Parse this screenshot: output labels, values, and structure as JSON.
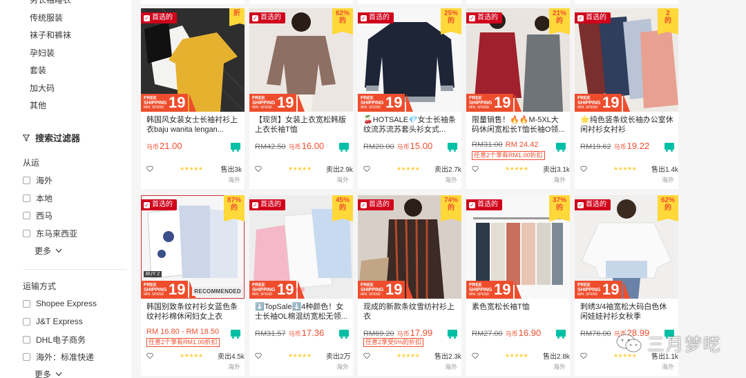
{
  "sidebar": {
    "categories": [
      "男长袖睡衣",
      "传统服装",
      "袜子和裤袜",
      "孕妇装",
      "套装",
      "加大码",
      "其他"
    ],
    "filter_title": "搜索过滤器",
    "ship_from": {
      "title": "从运",
      "options": [
        "海外",
        "本地",
        "西马",
        "东马来西亚"
      ],
      "more": "更多"
    },
    "shipping": {
      "title": "运输方式",
      "options": [
        "Shopee Express",
        "J&T Express",
        "DHL电子商务",
        "海外：标准快递"
      ],
      "more": "更多"
    }
  },
  "badges": {
    "pick": "首选的",
    "free_shipping": "FREE SHIPPING",
    "min_spend": "MIN. SPEND",
    "spend_amount": "19",
    "recommended": "RECOMMENDED",
    "buy2": "BUY 2",
    "disc_suffix": "折",
    "disc_small": "的"
  },
  "colors": {
    "brand": "#ee4d2d",
    "pick": "#d0011b",
    "star": "#ffce3d",
    "free": "#00bfa5"
  },
  "products": [
    {
      "title": "韩国风女装女士长袖衬衫上衣baju wanita lengan...",
      "orig": "",
      "price": "21.00",
      "currency": "马币",
      "promo": "",
      "sold": "售出3k",
      "loc": "海外",
      "disc": ""
    },
    {
      "title": "【现货】女装上衣宽松韩版上衣长袖T恤",
      "orig": "RM42.50",
      "price": "16.00",
      "currency": "马币",
      "promo": "",
      "sold": "卖出2.9k",
      "loc": "海外",
      "disc": "62%"
    },
    {
      "title": "🍒HOTSALE💎女士长袖条纹流苏流苏套头衫女式...",
      "orig": "RM20.00",
      "price": "15.00",
      "currency": "马币",
      "promo": "",
      "sold": "卖出2.7k",
      "loc": "海外",
      "disc": "25%"
    },
    {
      "title": "限量销售！🔥🔥M-5XL大码休闲宽松长T恤长袖O领...",
      "orig": "RM31.00",
      "price": "RM 24.42",
      "currency": "",
      "promo": "任意2个享有RM1.00折扣",
      "sold": "卖出3.1k",
      "loc": "海外",
      "disc": "21%"
    },
    {
      "title": "🌟纯色竖条纹长袖办公室休闲衬衫女衬衫",
      "orig": "RM19.62",
      "price": "19.22",
      "currency": "马币",
      "promo": "",
      "sold": "售出1.4k",
      "loc": "海外",
      "disc": "2"
    },
    {
      "title": "韩国别致条纹衬衫女蓝色条纹衬衫棉休闲妇女上衣",
      "orig": "",
      "price": "RM 16.80 - RM 18.50",
      "currency": "",
      "promo": "任意2个享有RM1.00折扣",
      "sold": "卖出4.5k",
      "loc": "海外",
      "disc": "87%"
    },
    {
      "title": "⬇️TopSale⬇️4种颜色！女士长袖OL棉混纺宽松无领...",
      "orig": "RM31.57",
      "price": "17.36",
      "currency": "马币",
      "promo": "",
      "sold": "卖出2万",
      "loc": "海外",
      "disc": "45%"
    },
    {
      "title": "现成的新款条纹雪纺衬衫上衣",
      "orig": "RM69.20",
      "price": "17.99",
      "currency": "马币",
      "promo": "任意2享受5%的折扣",
      "sold": "售出2.3k",
      "loc": "海外",
      "disc": "74%"
    },
    {
      "title": "素色宽松长袖T恤",
      "orig": "RM27.00",
      "price": "16.90",
      "currency": "马币",
      "promo": "",
      "sold": "售出2.8k",
      "loc": "海外",
      "disc": "37%"
    },
    {
      "title": "刺绣3/4袖宽松大码白色休闲娃娃衬衫女秋季",
      "orig": "RM76.00",
      "price": "28.99",
      "currency": "马币",
      "promo": "",
      "sold": "售出1.1k",
      "loc": "海外",
      "disc": "62%"
    }
  ],
  "watermark": "三月梦呓"
}
